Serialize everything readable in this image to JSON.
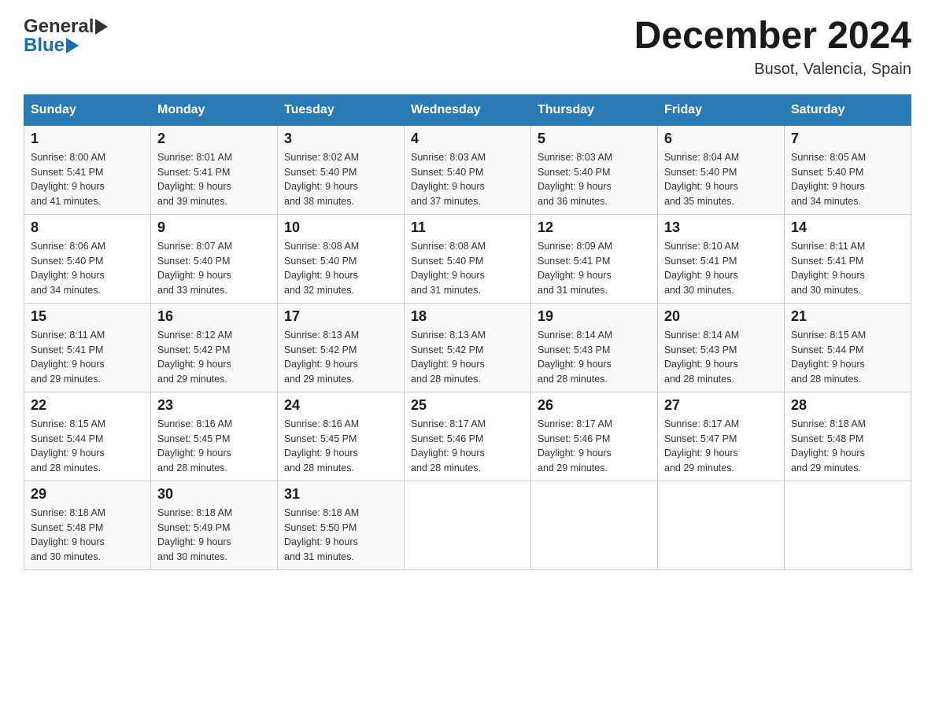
{
  "header": {
    "logo_general": "General",
    "logo_blue": "Blue",
    "month_title": "December 2024",
    "location": "Busot, Valencia, Spain"
  },
  "weekdays": [
    "Sunday",
    "Monday",
    "Tuesday",
    "Wednesday",
    "Thursday",
    "Friday",
    "Saturday"
  ],
  "weeks": [
    [
      {
        "day": "1",
        "sunrise": "8:00 AM",
        "sunset": "5:41 PM",
        "daylight": "9 hours and 41 minutes."
      },
      {
        "day": "2",
        "sunrise": "8:01 AM",
        "sunset": "5:41 PM",
        "daylight": "9 hours and 39 minutes."
      },
      {
        "day": "3",
        "sunrise": "8:02 AM",
        "sunset": "5:40 PM",
        "daylight": "9 hours and 38 minutes."
      },
      {
        "day": "4",
        "sunrise": "8:03 AM",
        "sunset": "5:40 PM",
        "daylight": "9 hours and 37 minutes."
      },
      {
        "day": "5",
        "sunrise": "8:03 AM",
        "sunset": "5:40 PM",
        "daylight": "9 hours and 36 minutes."
      },
      {
        "day": "6",
        "sunrise": "8:04 AM",
        "sunset": "5:40 PM",
        "daylight": "9 hours and 35 minutes."
      },
      {
        "day": "7",
        "sunrise": "8:05 AM",
        "sunset": "5:40 PM",
        "daylight": "9 hours and 34 minutes."
      }
    ],
    [
      {
        "day": "8",
        "sunrise": "8:06 AM",
        "sunset": "5:40 PM",
        "daylight": "9 hours and 34 minutes."
      },
      {
        "day": "9",
        "sunrise": "8:07 AM",
        "sunset": "5:40 PM",
        "daylight": "9 hours and 33 minutes."
      },
      {
        "day": "10",
        "sunrise": "8:08 AM",
        "sunset": "5:40 PM",
        "daylight": "9 hours and 32 minutes."
      },
      {
        "day": "11",
        "sunrise": "8:08 AM",
        "sunset": "5:40 PM",
        "daylight": "9 hours and 31 minutes."
      },
      {
        "day": "12",
        "sunrise": "8:09 AM",
        "sunset": "5:41 PM",
        "daylight": "9 hours and 31 minutes."
      },
      {
        "day": "13",
        "sunrise": "8:10 AM",
        "sunset": "5:41 PM",
        "daylight": "9 hours and 30 minutes."
      },
      {
        "day": "14",
        "sunrise": "8:11 AM",
        "sunset": "5:41 PM",
        "daylight": "9 hours and 30 minutes."
      }
    ],
    [
      {
        "day": "15",
        "sunrise": "8:11 AM",
        "sunset": "5:41 PM",
        "daylight": "9 hours and 29 minutes."
      },
      {
        "day": "16",
        "sunrise": "8:12 AM",
        "sunset": "5:42 PM",
        "daylight": "9 hours and 29 minutes."
      },
      {
        "day": "17",
        "sunrise": "8:13 AM",
        "sunset": "5:42 PM",
        "daylight": "9 hours and 29 minutes."
      },
      {
        "day": "18",
        "sunrise": "8:13 AM",
        "sunset": "5:42 PM",
        "daylight": "9 hours and 28 minutes."
      },
      {
        "day": "19",
        "sunrise": "8:14 AM",
        "sunset": "5:43 PM",
        "daylight": "9 hours and 28 minutes."
      },
      {
        "day": "20",
        "sunrise": "8:14 AM",
        "sunset": "5:43 PM",
        "daylight": "9 hours and 28 minutes."
      },
      {
        "day": "21",
        "sunrise": "8:15 AM",
        "sunset": "5:44 PM",
        "daylight": "9 hours and 28 minutes."
      }
    ],
    [
      {
        "day": "22",
        "sunrise": "8:15 AM",
        "sunset": "5:44 PM",
        "daylight": "9 hours and 28 minutes."
      },
      {
        "day": "23",
        "sunrise": "8:16 AM",
        "sunset": "5:45 PM",
        "daylight": "9 hours and 28 minutes."
      },
      {
        "day": "24",
        "sunrise": "8:16 AM",
        "sunset": "5:45 PM",
        "daylight": "9 hours and 28 minutes."
      },
      {
        "day": "25",
        "sunrise": "8:17 AM",
        "sunset": "5:46 PM",
        "daylight": "9 hours and 28 minutes."
      },
      {
        "day": "26",
        "sunrise": "8:17 AM",
        "sunset": "5:46 PM",
        "daylight": "9 hours and 29 minutes."
      },
      {
        "day": "27",
        "sunrise": "8:17 AM",
        "sunset": "5:47 PM",
        "daylight": "9 hours and 29 minutes."
      },
      {
        "day": "28",
        "sunrise": "8:18 AM",
        "sunset": "5:48 PM",
        "daylight": "9 hours and 29 minutes."
      }
    ],
    [
      {
        "day": "29",
        "sunrise": "8:18 AM",
        "sunset": "5:48 PM",
        "daylight": "9 hours and 30 minutes."
      },
      {
        "day": "30",
        "sunrise": "8:18 AM",
        "sunset": "5:49 PM",
        "daylight": "9 hours and 30 minutes."
      },
      {
        "day": "31",
        "sunrise": "8:18 AM",
        "sunset": "5:50 PM",
        "daylight": "9 hours and 31 minutes."
      },
      null,
      null,
      null,
      null
    ]
  ]
}
